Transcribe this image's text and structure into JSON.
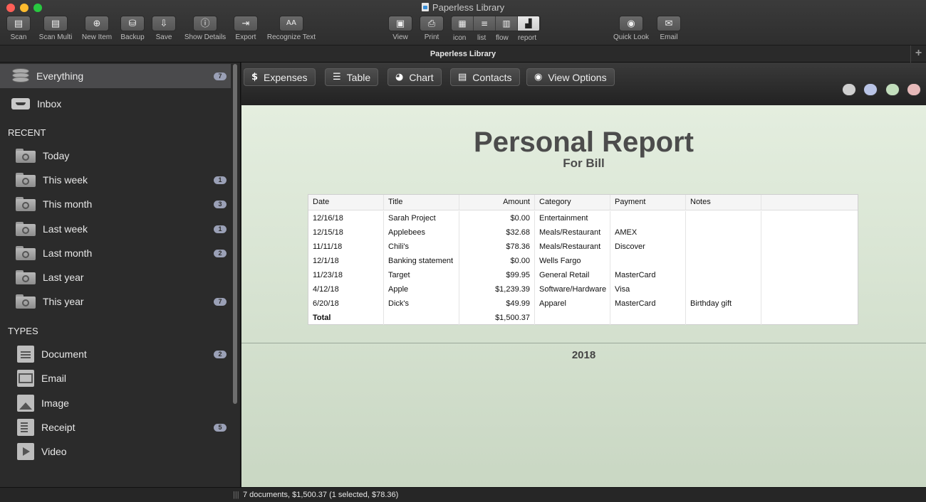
{
  "window": {
    "title": "Paperless Library"
  },
  "toolbar": {
    "scan": "Scan",
    "scan_multi": "Scan Multi",
    "new_item": "New Item",
    "backup": "Backup",
    "save": "Save",
    "show_details": "Show Details",
    "export": "Export",
    "recognize_text": "Recognize Text",
    "view": "View",
    "print": "Print",
    "icon": "icon",
    "list": "list",
    "flow": "flow",
    "report": "report",
    "quick_look": "Quick Look",
    "email": "Email",
    "selected_view": "report"
  },
  "library_bar": {
    "title": "Paperless Library",
    "add": "+"
  },
  "sidebar": {
    "everything": {
      "label": "Everything",
      "count": "7"
    },
    "inbox": {
      "label": "Inbox"
    },
    "recent_header": "RECENT",
    "recent": [
      {
        "label": "Today",
        "count": ""
      },
      {
        "label": "This week",
        "count": "1"
      },
      {
        "label": "This month",
        "count": "3"
      },
      {
        "label": "Last week",
        "count": "1"
      },
      {
        "label": "Last month",
        "count": "2"
      },
      {
        "label": "Last year",
        "count": ""
      },
      {
        "label": "This year",
        "count": "7"
      }
    ],
    "types_header": "TYPES",
    "types": [
      {
        "label": "Document",
        "count": "2",
        "icon": "document-icon"
      },
      {
        "label": "Email",
        "count": "",
        "icon": "email-icon"
      },
      {
        "label": "Image",
        "count": "",
        "icon": "image-icon"
      },
      {
        "label": "Receipt",
        "count": "5",
        "icon": "receipt-icon"
      },
      {
        "label": "Video",
        "count": "",
        "icon": "video-icon"
      }
    ]
  },
  "report_tabs": {
    "expenses": "Expenses",
    "table": "Table",
    "chart": "Chart",
    "contacts": "Contacts",
    "view_options": "View Options",
    "glyph_dollar": "$"
  },
  "swatches": [
    "#cfcfcf",
    "#b9c4e6",
    "#c3dfbd",
    "#e6b9b9"
  ],
  "report": {
    "title": "Personal Report",
    "subtitle": "For Bill",
    "columns": [
      "Date",
      "Title",
      "Amount",
      "Category",
      "Payment",
      "Notes",
      ""
    ],
    "rows": [
      [
        "12/16/18",
        "Sarah Project",
        "$0.00",
        "Entertainment",
        "",
        "",
        ""
      ],
      [
        "12/15/18",
        "Applebees",
        "$32.68",
        "Meals/Restaurant",
        "AMEX",
        "",
        ""
      ],
      [
        "11/11/18",
        "Chili's",
        "$78.36",
        "Meals/Restaurant",
        "Discover",
        "",
        ""
      ],
      [
        "12/1/18",
        "Banking statement",
        "$0.00",
        "Wells Fargo",
        "",
        "",
        ""
      ],
      [
        "11/23/18",
        "Target",
        "$99.95",
        "General Retail",
        "MasterCard",
        "",
        ""
      ],
      [
        "4/12/18",
        "Apple",
        "$1,239.39",
        "Software/Hardware",
        "Visa",
        "",
        ""
      ],
      [
        "6/20/18",
        "Dick's",
        "$49.99",
        "Apparel",
        "MasterCard",
        "Birthday gift",
        ""
      ]
    ],
    "total_label": "Total",
    "total_amount": "$1,500.37",
    "year": "2018"
  },
  "status": {
    "text": "7 documents, $1,500.37 (1 selected, $78.36)"
  }
}
